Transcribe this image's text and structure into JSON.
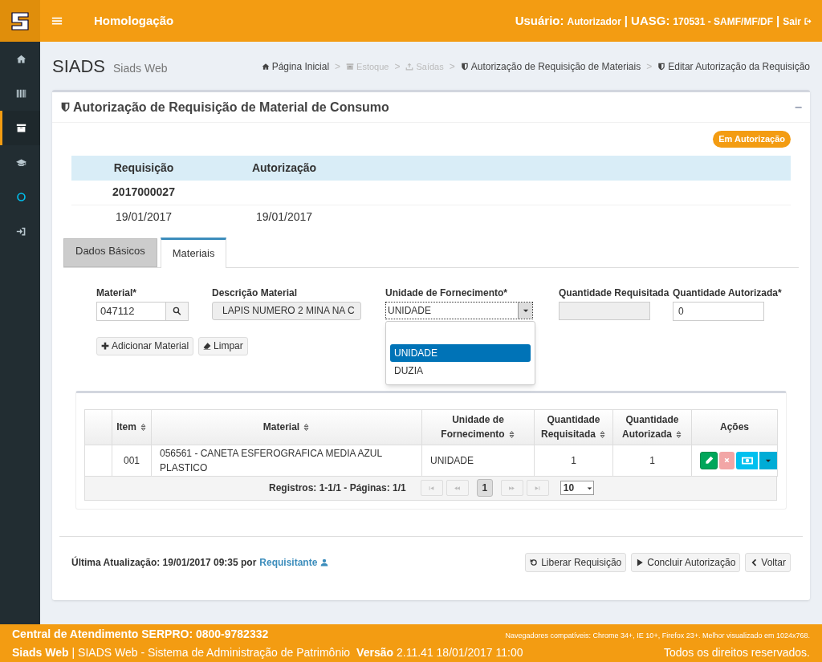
{
  "header": {
    "title": "Homologação",
    "user_label": "Usuário:",
    "user": "Autorizador",
    "uasg_label": "UASG:",
    "uasg": "170531 - SAMF/MF/DF",
    "separators": [
      "|",
      "|"
    ],
    "logout": "Sair"
  },
  "sidebar": {
    "items": [
      {
        "kind": "home",
        "selected": false
      },
      {
        "kind": "barcode",
        "selected": false
      },
      {
        "kind": "archive",
        "selected": true
      },
      {
        "kind": "cap",
        "selected": false
      },
      {
        "kind": "circle",
        "selected": false
      },
      {
        "kind": "signin",
        "selected": false
      }
    ]
  },
  "page": {
    "title": "SIADS",
    "subtitle": "Siads Web"
  },
  "breadcrumb": [
    {
      "kind": "home",
      "label": "Página Inicial",
      "disabled": false
    },
    {
      "separator": ">",
      "kind": "archive",
      "label": "Estoque",
      "disabled": true
    },
    {
      "separator": ">",
      "kind": "upload",
      "label": "Saídas",
      "disabled": true
    },
    {
      "separator": ">",
      "kind": "shield",
      "label": "Autorização de Requisição de Materiais",
      "disabled": false
    },
    {
      "separator": ">",
      "kind": "shield",
      "label": "Editar Autorização da Requisição",
      "disabled": false
    }
  ],
  "card": {
    "title": "Autorização de Requisição de Material de Consumo",
    "collapse": "−",
    "status_badge": "Em Autorização",
    "summary": {
      "columns": [
        "Requisição",
        "Autorização"
      ],
      "number": "2017000027",
      "dates": [
        "19/01/2017",
        "19/01/2017"
      ]
    },
    "tabs": [
      {
        "label": "Dados Básicos",
        "selected": false
      },
      {
        "label": "Materiais",
        "selected": true
      }
    ],
    "form": {
      "material": {
        "label": "Material*",
        "value": "047112"
      },
      "description": {
        "label": "Descrição Material",
        "value": "LAPIS NUMERO 2 MINA NA C"
      },
      "unit": {
        "label": "Unidade de Fornecimento*",
        "value": "UNIDADE",
        "expanded": true,
        "options": [
          {
            "label": "UNIDADE",
            "selected": true
          },
          {
            "label": "DUZIA",
            "selected": false
          }
        ]
      },
      "requested": {
        "label": "Quantidade Requisitada"
      },
      "authorized": {
        "label": "Quantidade Autorizada*",
        "value": "0"
      },
      "buttons": [
        {
          "kind": "add",
          "label": "Adicionar Material"
        },
        {
          "kind": "clear",
          "label": "Limpar"
        }
      ]
    },
    "table": {
      "columns": [
        {
          "label": "Item",
          "sortable": true
        },
        {
          "label": "Material",
          "sortable": true
        },
        {
          "label": "Unidade de Fornecimento",
          "sortable": true
        },
        {
          "label": "Quantidade Requisitada",
          "sortable": true
        },
        {
          "label": "Quantidade Autorizada",
          "sortable": true
        },
        {
          "label": "Ações",
          "sortable": false
        }
      ],
      "rows": [
        {
          "item": "001",
          "material": "056561 - CANETA ESFEROGRAFICA MEDIA AZUL PLASTICO",
          "unit": "UNIDADE",
          "requested": "1",
          "authorized": "1"
        }
      ],
      "pager": {
        "summary": "Registros: 1-1/1 - Páginas: 1/1",
        "pages": [
          {
            "label": "1",
            "selected": true
          }
        ],
        "page_size": "10"
      }
    },
    "last_update": {
      "label": "Última Atualização: 19/01/2017 09:35 por",
      "user": "Requisitante"
    },
    "actions": [
      {
        "kind": "undo",
        "label": "Liberar Requisição"
      },
      {
        "kind": "play",
        "label": "Concluir Autorização"
      },
      {
        "kind": "back",
        "label": "Voltar"
      }
    ]
  },
  "footer": {
    "contact": "Central de Atendimento SERPRO: 0800-9782332",
    "browsers": "Navegadores compatíveis: Chrome 34+, IE 10+, Firefox 23+. Melhor visualizado em 1024x768.",
    "app": "Siads Web",
    "app_desc": "| SIADS Web - Sistema de Administração de Patrimônio",
    "version_label": "Versão",
    "version": "2.11.41 18/01/2017 11:00",
    "rights": "Todos os direitos reservados."
  }
}
